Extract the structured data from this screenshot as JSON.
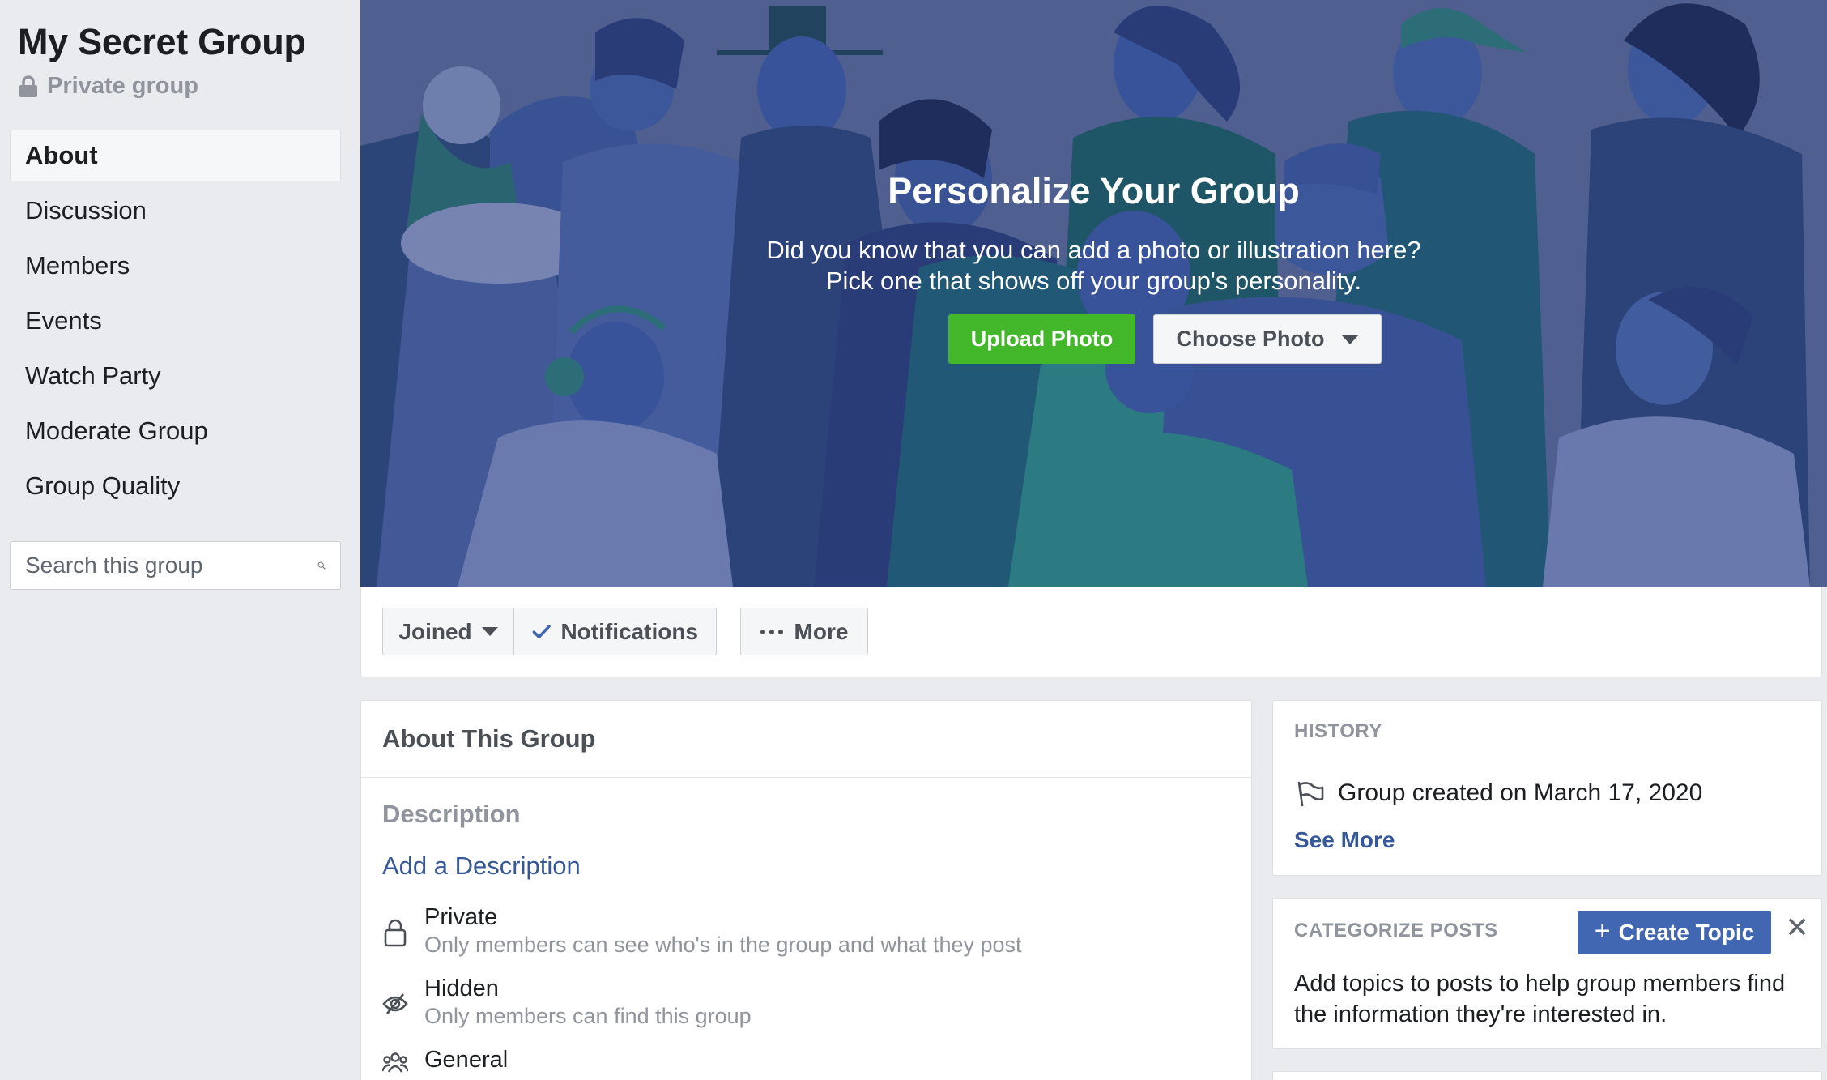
{
  "sidebar": {
    "group_name": "My Secret Group",
    "privacy_label": "Private group",
    "nav": [
      {
        "label": "About",
        "active": true
      },
      {
        "label": "Discussion"
      },
      {
        "label": "Members"
      },
      {
        "label": "Events"
      },
      {
        "label": "Watch Party"
      },
      {
        "label": "Moderate Group"
      },
      {
        "label": "Group Quality"
      }
    ],
    "search_placeholder": "Search this group"
  },
  "cover": {
    "title": "Personalize Your Group",
    "subtitle_line1": "Did you know that you can add a photo or illustration here?",
    "subtitle_line2": "Pick one that shows off your group's personality.",
    "upload_label": "Upload Photo",
    "choose_label": "Choose Photo"
  },
  "actions": {
    "joined_label": "Joined",
    "notifications_label": "Notifications",
    "more_label": "More"
  },
  "about": {
    "header": "About This Group",
    "description_label": "Description",
    "add_description": "Add a Description",
    "private_title": "Private",
    "private_sub": "Only members can see who's in the group and what they post",
    "hidden_title": "Hidden",
    "hidden_sub": "Only members can find this group",
    "general_title": "General"
  },
  "history": {
    "caption": "HISTORY",
    "created": "Group created on March 17, 2020",
    "see_more": "See More"
  },
  "categorize": {
    "caption": "CATEGORIZE POSTS",
    "create_label": "Create Topic",
    "close_glyph": "✕",
    "text": "Add topics to posts to help group members find the information they're interested in."
  },
  "colors": {
    "accent_blue": "#4267b2",
    "link_blue": "#365899",
    "upload_green": "#42b72a",
    "cover_bg": "#5b6b9d"
  },
  "icons": [
    "lock-icon",
    "search-icon",
    "caret-down-icon",
    "check-icon",
    "ellipsis-icon",
    "padlock-icon",
    "hidden-eye-icon",
    "people-icon",
    "flag-icon",
    "plus-icon",
    "close-icon"
  ]
}
